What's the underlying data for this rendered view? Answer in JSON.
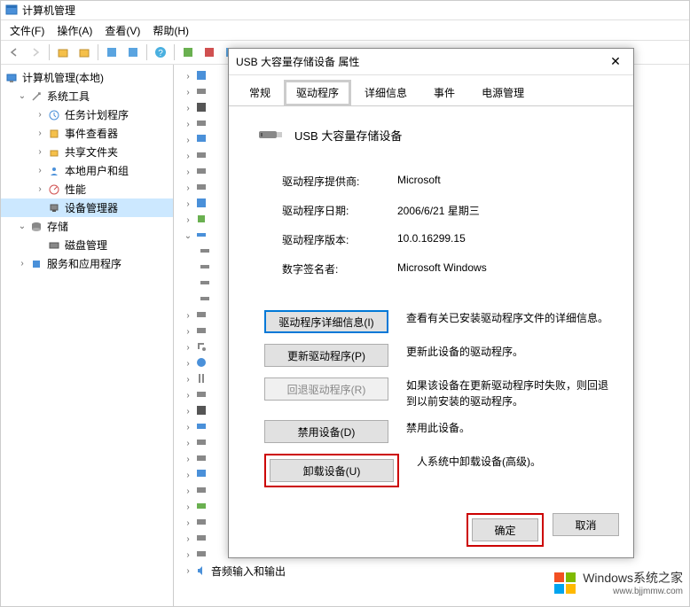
{
  "window": {
    "title": "计算机管理"
  },
  "menu": {
    "file": "文件(F)",
    "action": "操作(A)",
    "view": "查看(V)",
    "help": "帮助(H)"
  },
  "tree": {
    "root": "计算机管理(本地)",
    "systools": "系统工具",
    "taskscheduler": "任务计划程序",
    "eventviewer": "事件查看器",
    "sharedfolders": "共享文件夹",
    "localusers": "本地用户和组",
    "performance": "性能",
    "devicemgr": "设备管理器",
    "storage": "存储",
    "diskmgr": "磁盘管理",
    "services": "服务和应用程序"
  },
  "device_list": {
    "audio": "音频输入和输出"
  },
  "dialog": {
    "title": "USB 大容量存储设备 属性",
    "tabs": {
      "general": "常规",
      "driver": "驱动程序",
      "details": "详细信息",
      "events": "事件",
      "power": "电源管理"
    },
    "device_name": "USB 大容量存储设备",
    "info": {
      "provider_label": "驱动程序提供商:",
      "provider_value": "Microsoft",
      "date_label": "驱动程序日期:",
      "date_value": "2006/6/21 星期三",
      "version_label": "驱动程序版本:",
      "version_value": "10.0.16299.15",
      "signer_label": "数字签名者:",
      "signer_value": "Microsoft Windows"
    },
    "actions": {
      "details_btn": "驱动程序详细信息(I)",
      "details_desc": "查看有关已安装驱动程序文件的详细信息。",
      "update_btn": "更新驱动程序(P)",
      "update_desc": "更新此设备的驱动程序。",
      "rollback_btn": "回退驱动程序(R)",
      "rollback_desc": "如果该设备在更新驱动程序时失败，则回退到以前安装的驱动程序。",
      "disable_btn": "禁用设备(D)",
      "disable_desc": "禁用此设备。",
      "uninstall_btn": "卸载设备(U)",
      "uninstall_desc": "人系统中卸载设备(高级)。"
    },
    "footer": {
      "ok": "确定",
      "cancel": "取消"
    }
  },
  "watermark": {
    "text": "Windows系统之家",
    "url": "www.bjjmmw.com"
  }
}
